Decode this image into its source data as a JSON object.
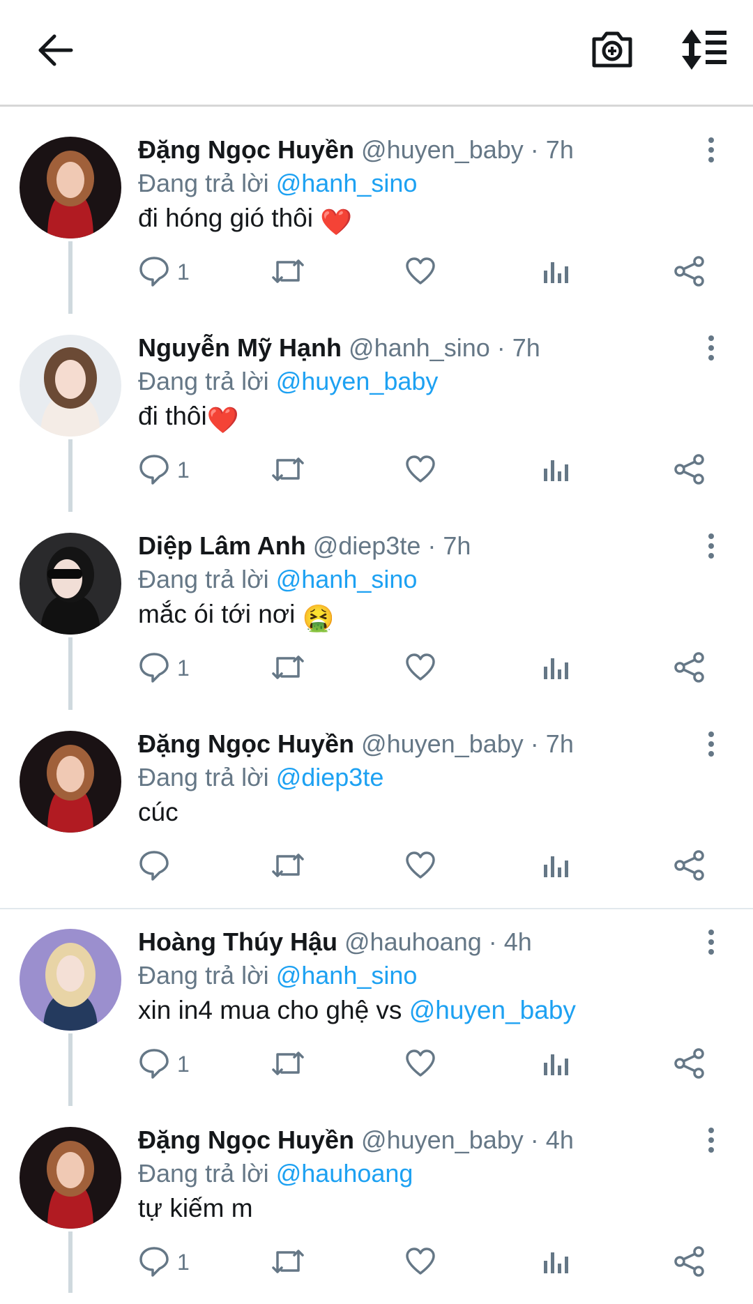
{
  "topbar": {
    "back_icon": "arrow-left-icon",
    "camera_icon": "camera-add-icon",
    "sort_icon": "sort-list-icon"
  },
  "tweets": [
    {
      "name": "Đặng Ngọc Huyền",
      "handle": "@huyen_baby",
      "time": "7h",
      "replying_label": "Đang trả lời",
      "replying_to": "@hanh_sino",
      "text": "đi hóng gió thôi",
      "emoji": "❤️",
      "reply_count": "1"
    },
    {
      "name": "Nguyễn Mỹ Hạnh",
      "handle": "@hanh_sino",
      "time": "7h",
      "replying_label": "Đang trả lời",
      "replying_to": "@huyen_baby",
      "text": "đi thôi",
      "emoji": "❤️",
      "reply_count": "1"
    },
    {
      "name": "Diệp Lâm Anh",
      "handle": "@diep3te",
      "time": "7h",
      "replying_label": "Đang trả lời",
      "replying_to": "@hanh_sino",
      "text": "mắc ói tới nơi",
      "emoji": "🤮",
      "reply_count": "1"
    },
    {
      "name": "Đặng Ngọc Huyền",
      "handle": "@huyen_baby",
      "time": "7h",
      "replying_label": "Đang trả lời",
      "replying_to": "@diep3te",
      "text": "cúc",
      "emoji": "",
      "reply_count": ""
    },
    {
      "name": "Hoàng Thúy Hậu",
      "handle": "@hauhoang",
      "time": "4h",
      "replying_label": "Đang trả lời",
      "replying_to": "@hanh_sino",
      "text": "xin in4 mua cho ghệ vs",
      "text_mention": "@huyen_baby",
      "reply_count": "1"
    },
    {
      "name": "Đặng Ngọc Huyền",
      "handle": "@huyen_baby",
      "time": "4h",
      "replying_label": "Đang trả lời",
      "replying_to": "@hauhoang",
      "text": "tự kiếm m",
      "emoji": "",
      "reply_count": "1"
    }
  ],
  "dot_separator": "·",
  "icons": {
    "reply": "speech-bubble-icon",
    "retweet": "retweet-icon",
    "like": "heart-icon",
    "views": "bar-chart-icon",
    "share": "share-icon",
    "more": "more-vertical-icon"
  },
  "colors": {
    "link": "#1da1f2",
    "muted": "#657786",
    "text": "#14171a"
  }
}
